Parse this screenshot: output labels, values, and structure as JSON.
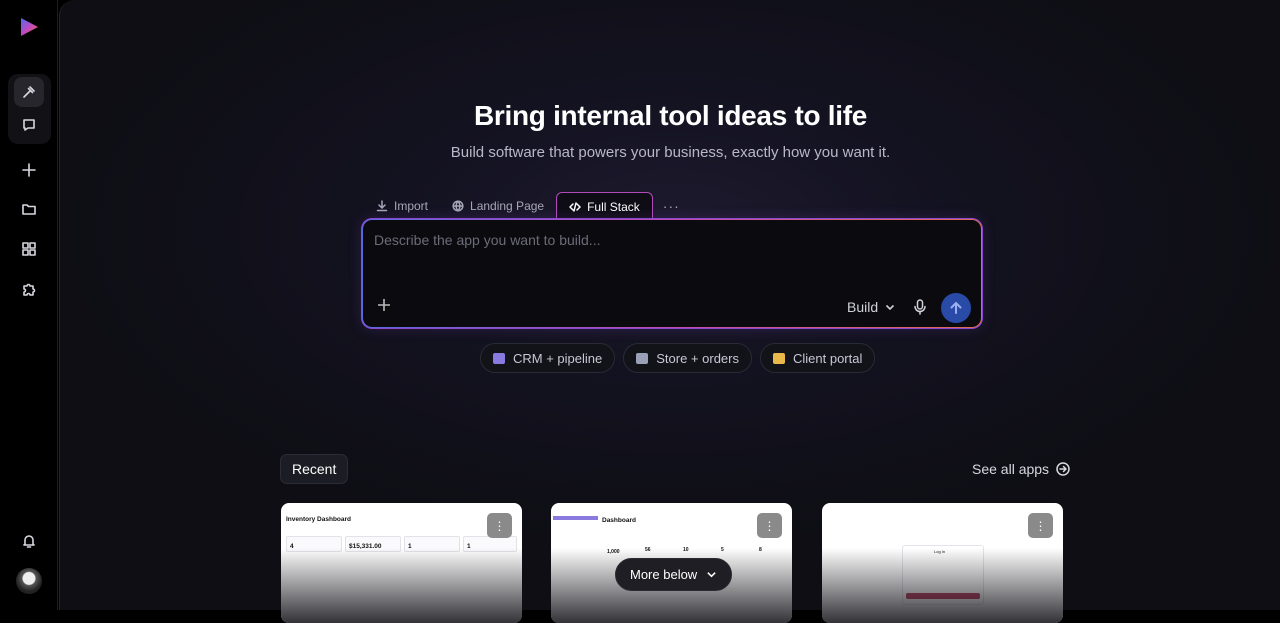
{
  "hero": {
    "title": "Bring internal tool ideas to life",
    "subtitle": "Build software that powers your business, exactly how you want it."
  },
  "tabs": [
    {
      "label": "Import",
      "icon": "download-icon"
    },
    {
      "label": "Landing Page",
      "icon": "globe-icon"
    },
    {
      "label": "Full Stack",
      "icon": "code-icon",
      "active": true
    },
    {
      "label": "···",
      "icon": "more-icon"
    }
  ],
  "prompt": {
    "placeholder": "Describe the app you want to build...",
    "mode_label": "Build"
  },
  "chips": [
    {
      "label": "CRM + pipeline",
      "color": "#8a7ae0"
    },
    {
      "label": "Store + orders",
      "color": "#9aa0b8"
    },
    {
      "label": "Client portal",
      "color": "#e8b84a"
    }
  ],
  "recent": {
    "label": "Recent",
    "see_all": "See all apps"
  },
  "cards": [
    {
      "title": "Inventory Dashboard",
      "values": [
        "4",
        "$15,331.00",
        "1",
        "1"
      ]
    },
    {
      "title": "Dashboard",
      "values": [
        "1,000",
        "56",
        "10",
        "5",
        "8"
      ]
    },
    {
      "title": "Log In",
      "values": []
    }
  ],
  "more_below": "More below",
  "colors": {
    "accent": "#2a4aa8",
    "gradient_start": "#5a6ae0",
    "gradient_end": "#e06a50"
  }
}
